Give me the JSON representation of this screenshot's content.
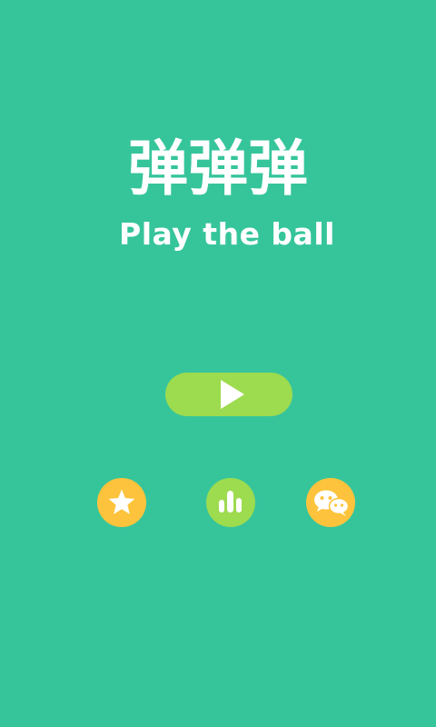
{
  "title": {
    "chinese": "弹弹弹",
    "english": "Play the ball"
  },
  "colors": {
    "background": "#36c59b",
    "play_button": "#9ddb4f",
    "star_button": "#fdc33c",
    "rank_button": "#9ddb4f",
    "chat_button": "#fdc33c",
    "text": "#ffffff"
  },
  "buttons": {
    "play": {
      "icon": "play-icon"
    },
    "rate": {
      "icon": "star-icon"
    },
    "leaderboard": {
      "icon": "bar-chart-icon"
    },
    "share": {
      "icon": "wechat-icon"
    }
  }
}
